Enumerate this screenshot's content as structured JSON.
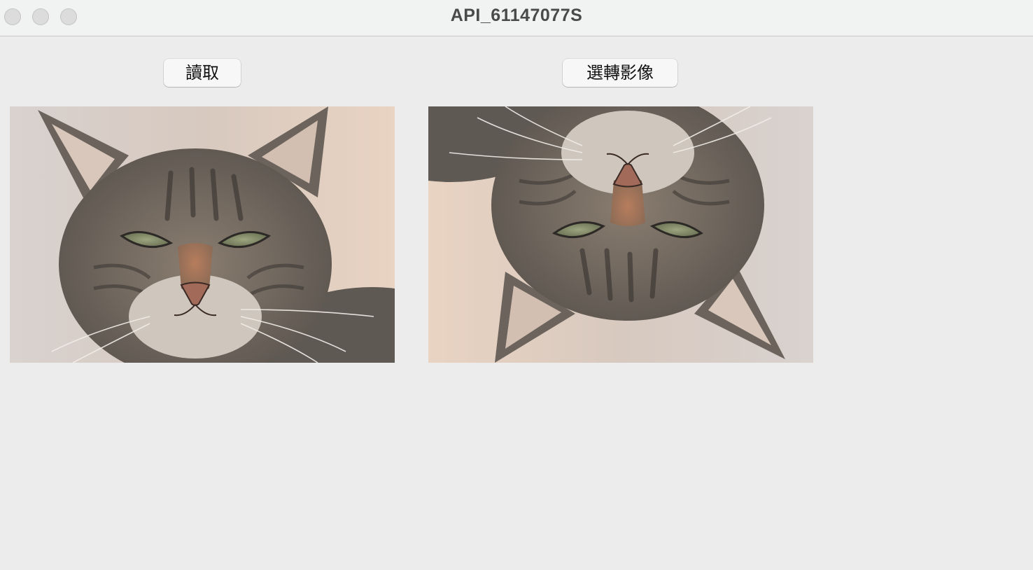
{
  "window": {
    "title": "API_61147077S"
  },
  "toolbar": {
    "read_label": "讀取",
    "rotate_label": "選轉影像"
  },
  "images": {
    "original": {
      "subject": "tabby cat face",
      "orientation": "upright"
    },
    "rotated": {
      "subject": "tabby cat face",
      "orientation": "rotated 180°"
    }
  },
  "colors": {
    "window_bg": "#ececec",
    "titlebar_bg": "#f1f3f3",
    "button_bg": "#f7f7f7",
    "title_text": "#4a4a4a"
  }
}
